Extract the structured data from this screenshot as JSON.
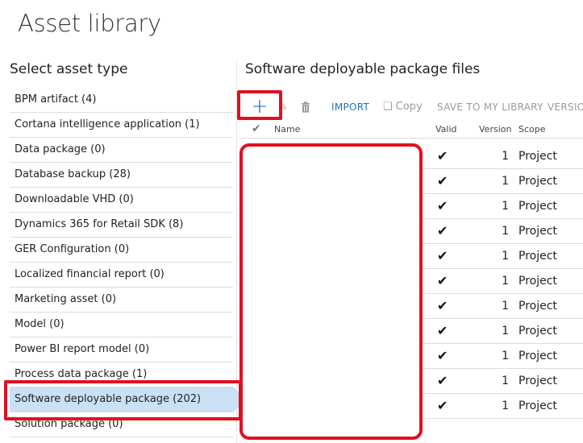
{
  "page_title": "Asset library",
  "left_panel": {
    "heading": "Select asset type",
    "items": [
      {
        "label": "BPM artifact (4)"
      },
      {
        "label": "Cortana intelligence application (1)"
      },
      {
        "label": "Data package (0)"
      },
      {
        "label": "Database backup (28)"
      },
      {
        "label": "Downloadable VHD (0)"
      },
      {
        "label": "Dynamics 365 for Retail SDK (8)"
      },
      {
        "label": "GER Configuration (0)"
      },
      {
        "label": "Localized financial report (0)"
      },
      {
        "label": "Marketing asset (0)"
      },
      {
        "label": "Model (0)"
      },
      {
        "label": "Power BI report model (0)"
      },
      {
        "label": "Process data package (1)"
      },
      {
        "label": "Software deployable package (202)",
        "selected": true
      },
      {
        "label": "Solution package (0)"
      }
    ]
  },
  "right_panel": {
    "heading": "Software deployable package files",
    "toolbar": {
      "add_label": "+",
      "edit_icon": "pencil-icon",
      "delete_icon": "trash-icon",
      "import_label": "IMPORT",
      "copy_label": "Copy",
      "save_label": "SAVE TO MY LIBRARY",
      "version_label": "VERSION"
    },
    "columns": {
      "select": "✔",
      "name": "Name",
      "valid": "Valid",
      "version": "Version",
      "scope": "Scope"
    },
    "rows": [
      {
        "valid": "✔",
        "version": "1",
        "scope": "Project"
      },
      {
        "valid": "✔",
        "version": "1",
        "scope": "Project"
      },
      {
        "valid": "✔",
        "version": "1",
        "scope": "Project"
      },
      {
        "valid": "✔",
        "version": "1",
        "scope": "Project"
      },
      {
        "valid": "✔",
        "version": "1",
        "scope": "Project"
      },
      {
        "valid": "✔",
        "version": "1",
        "scope": "Project"
      },
      {
        "valid": "✔",
        "version": "1",
        "scope": "Project"
      },
      {
        "valid": "✔",
        "version": "1",
        "scope": "Project"
      },
      {
        "valid": "✔",
        "version": "1",
        "scope": "Project"
      },
      {
        "valid": "✔",
        "version": "1",
        "scope": "Project"
      },
      {
        "valid": "✔",
        "version": "1",
        "scope": "Project"
      }
    ]
  },
  "colors": {
    "selection": "#c9e0f5",
    "highlight": "#e01020",
    "link": "#1a73c8",
    "add": "#0a67c5"
  }
}
